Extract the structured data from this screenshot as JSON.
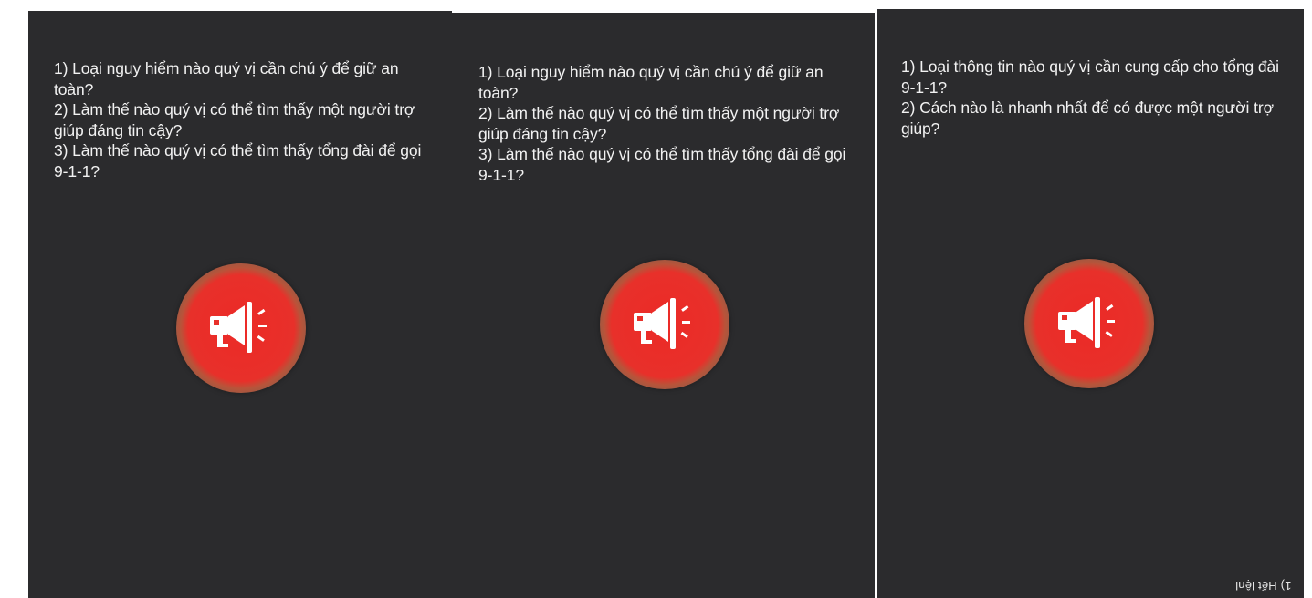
{
  "panels": [
    {
      "questions": [
        "1) Loại nguy hiểm nào quý vị cần chú ý để giữ an toàn?",
        "2) Làm thế nào quý vị có thể tìm thấy một người trợ giúp đáng tin cậy?",
        "3) Làm thế nào quý vị có thể tìm thấy tổng đài để gọi 9-1-1?"
      ],
      "button_icon": "megaphone-icon"
    },
    {
      "questions": [
        "1) Loại nguy hiểm nào quý vị cần chú ý để giữ an toàn?",
        "2) Làm thế nào quý vị có thể tìm thấy một người trợ giúp đáng tin cậy?",
        "3) Làm thế nào quý vị có thể tìm thấy tổng đài để gọi 9-1-1?"
      ],
      "button_icon": "megaphone-icon"
    },
    {
      "questions": [
        "1) Loại thông tin nào quý vị cần cung cấp cho tổng đài 9-1-1?",
        "2) Cách nào là nhanh nhất để có được một người trợ giúp?"
      ],
      "button_icon": "megaphone-icon",
      "corner_label": "1) Hết lệnl"
    }
  ],
  "colors": {
    "panel_background": "#2b2b2d",
    "text": "#f2f2f2",
    "alert_red": "#e8302a",
    "alert_ring": "#8a5a48"
  }
}
